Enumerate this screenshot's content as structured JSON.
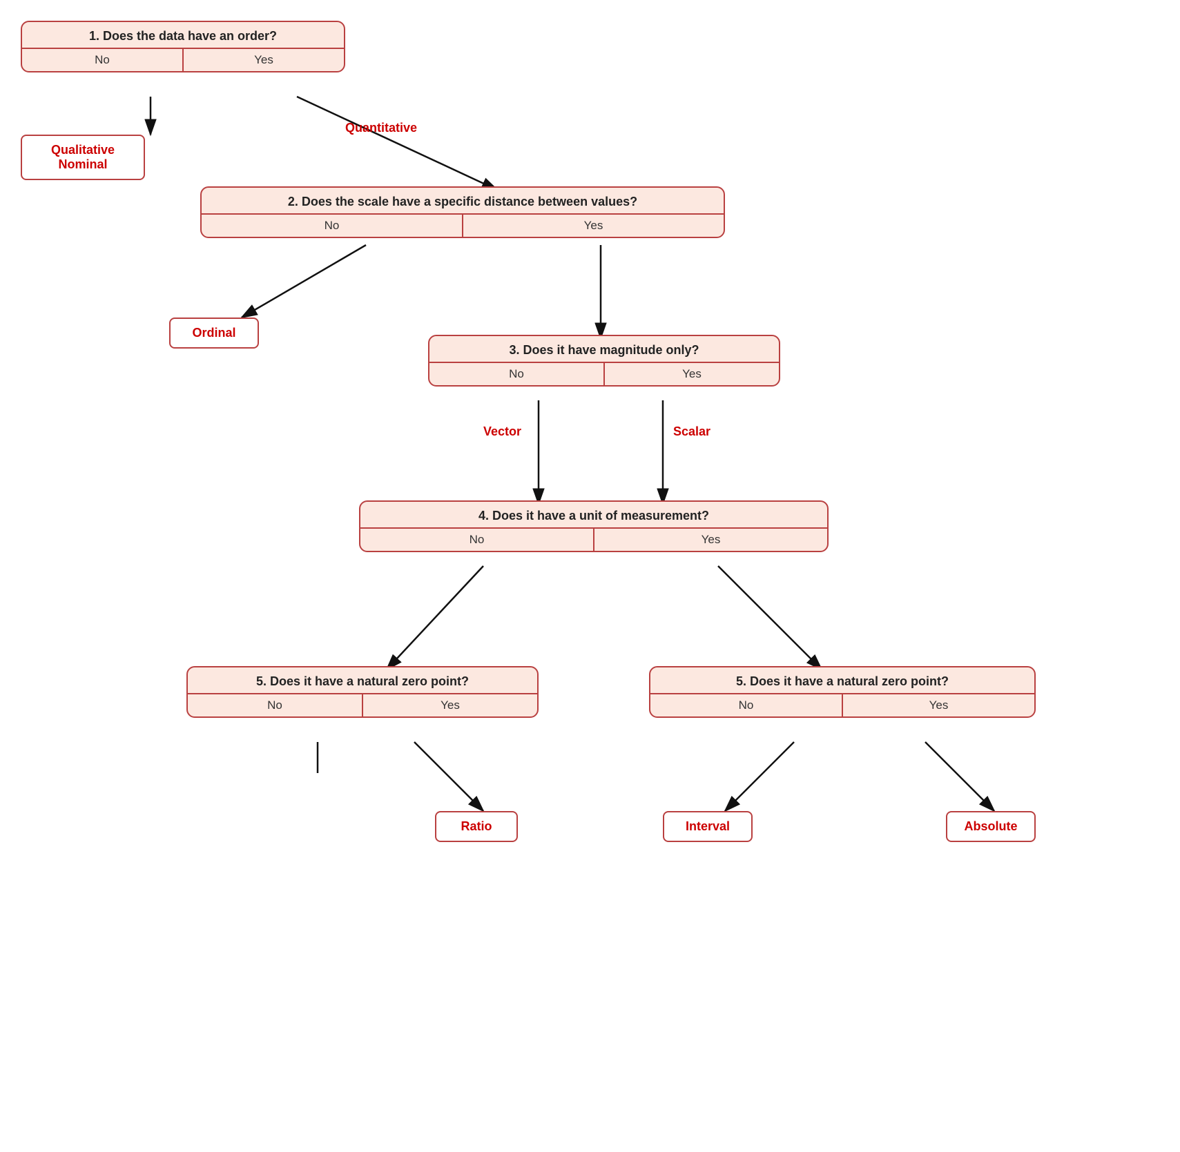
{
  "boxes": {
    "q1": {
      "question": "1. Does the data have an order?",
      "no": "No",
      "yes": "Yes"
    },
    "q2": {
      "question": "2. Does the scale have a specific distance between values?",
      "no": "No",
      "yes": "Yes"
    },
    "q3": {
      "question": "3. Does it have magnitude only?",
      "no": "No",
      "yes": "Yes"
    },
    "q4": {
      "question": "4. Does it have a unit of measurement?",
      "no": "No",
      "yes": "Yes"
    },
    "q5a": {
      "question": "5. Does it have a natural zero point?",
      "no": "No",
      "yes": "Yes"
    },
    "q5b": {
      "question": "5. Does it have a natural zero point?",
      "no": "No",
      "yes": "Yes"
    }
  },
  "terminals": {
    "nominal": "Qualitative\nNominal",
    "ordinal": "Ordinal",
    "ratio": "Ratio",
    "interval": "Interval",
    "absolute": "Absolute"
  },
  "labels": {
    "quantitative": "Quantitative",
    "vector": "Vector",
    "scalar": "Scalar"
  }
}
